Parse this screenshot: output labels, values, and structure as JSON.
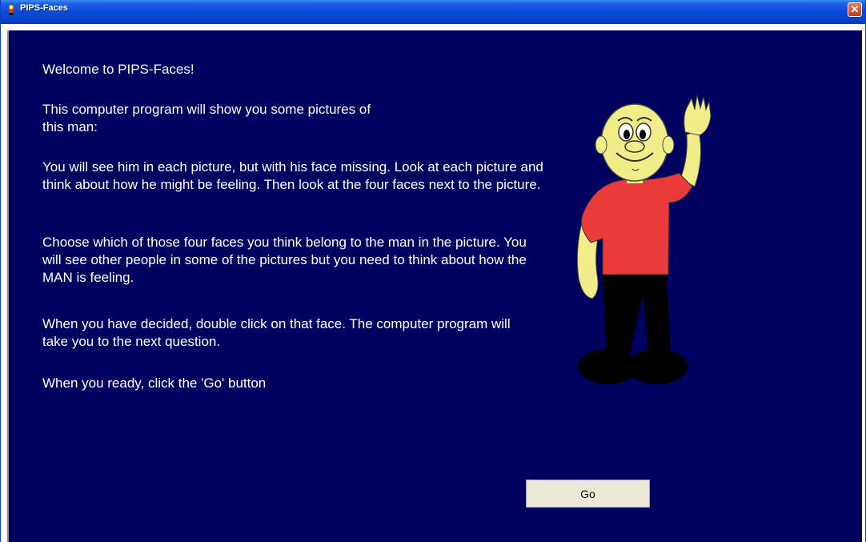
{
  "window": {
    "title": "PIPS-Faces",
    "close_label": "✕"
  },
  "instructions": {
    "welcome": "Welcome to PIPS-Faces!",
    "intro": "This computer program will show you some pictures of this man:",
    "face_missing": "You will see him in each picture, but with his face missing. Look at each picture and think about how he might be feeling. Then look at the four faces next to the picture.",
    "choose": "Choose which of those four faces you think belong to the man in the picture. You will see other people in some of the pictures but you need to think about how the MAN is feeling.",
    "double_click": "When you have decided, double click on that face. The computer program will take you to the next question.",
    "ready": "When you ready, click the 'Go' button"
  },
  "buttons": {
    "go": "Go"
  },
  "icons": {
    "title": "app-icon",
    "close": "close-icon",
    "character": "waving-man-illustration"
  },
  "colors": {
    "background": "#01015f",
    "text": "#ffffff",
    "shirt": "#ea3a3a",
    "skin": "#f1ee8a",
    "trousers": "#000000"
  }
}
